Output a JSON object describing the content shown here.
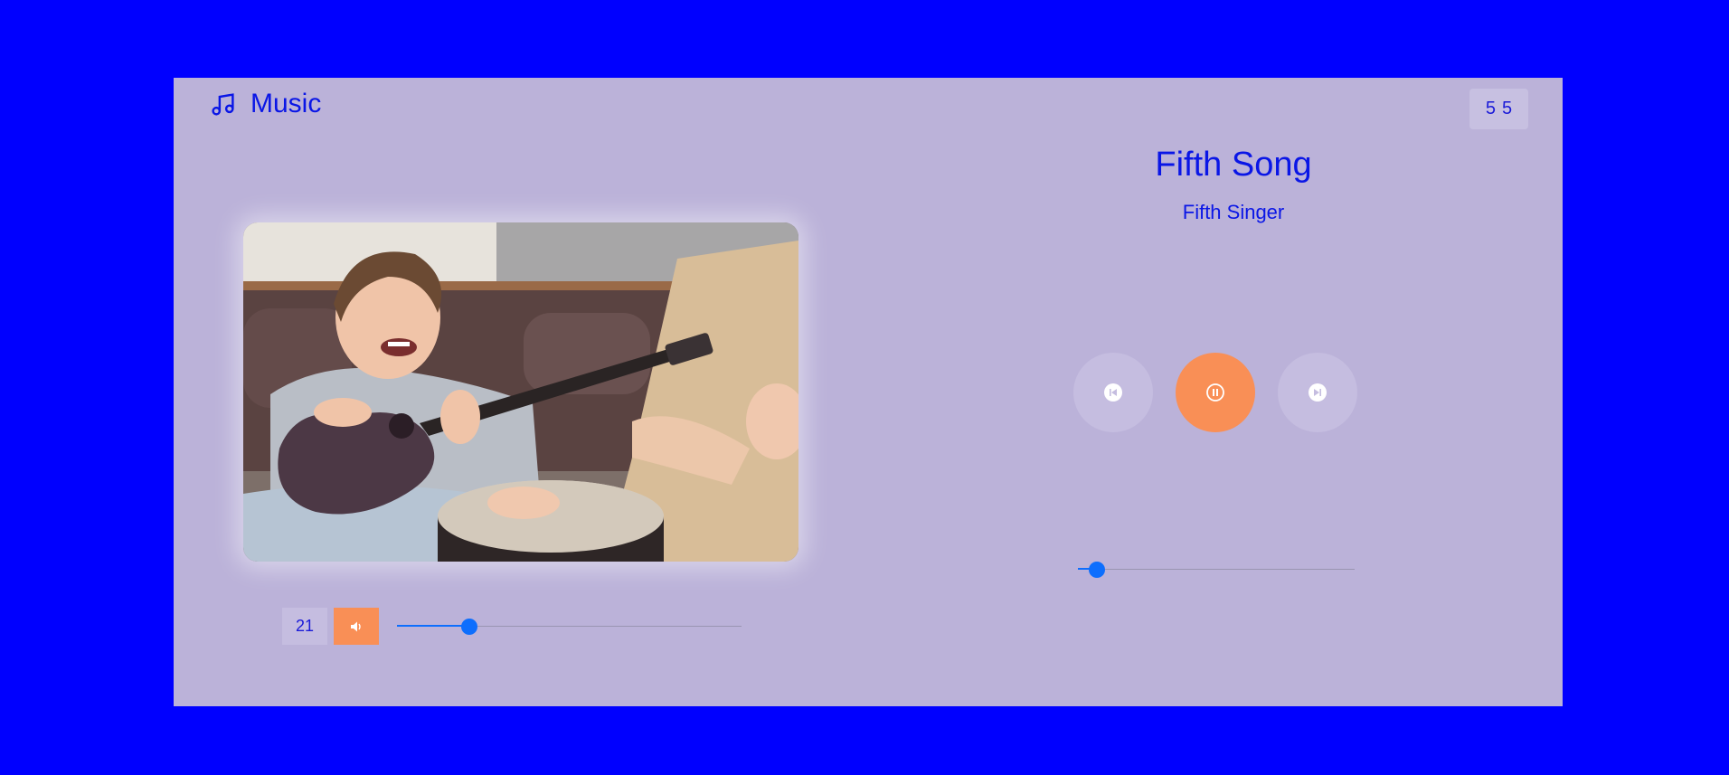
{
  "app": {
    "name": "Music",
    "logo_icon": "music-note-icon"
  },
  "counter": {
    "current": "5",
    "total": "5"
  },
  "song": {
    "title": "Fifth Song",
    "artist": "Fifth Singer"
  },
  "cover": {
    "alt": "Girl playing ukulele next to a person playing a drum"
  },
  "volume": {
    "value": "21",
    "level": 0.21,
    "icon": "volume-icon"
  },
  "progress": {
    "level": 0.07
  },
  "controls": {
    "prev_icon": "skip-previous-icon",
    "play_icon": "pause-icon",
    "next_icon": "skip-next-icon"
  },
  "colors": {
    "background": "#0000ff",
    "panel": "#bbb2d9",
    "accent": "#f98f56",
    "slider": "#0d6efd",
    "text": "#0a16e6"
  }
}
